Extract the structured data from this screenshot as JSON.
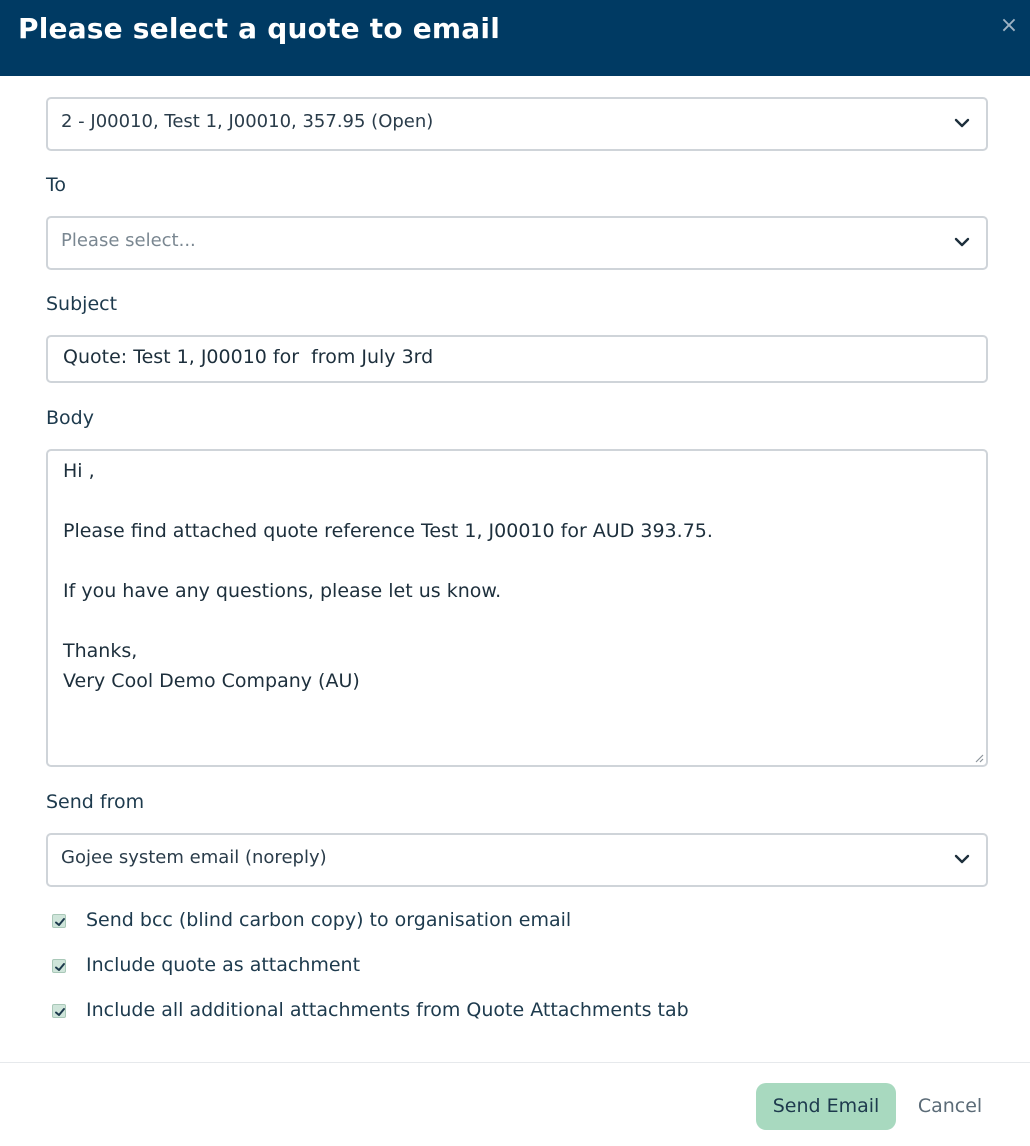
{
  "dialog": {
    "title": "Please select a quote to email",
    "close_glyph": "×"
  },
  "quote_select": {
    "selected": "2 - J00010, Test 1, J00010, 357.95 (Open)"
  },
  "to": {
    "label": "To",
    "placeholder": "Please select..."
  },
  "subject": {
    "label": "Subject",
    "value": "Quote: Test 1, J00010 for  from July 3rd"
  },
  "body": {
    "label": "Body",
    "lines": [
      "Hi ,",
      "",
      "Please find attached quote reference Test 1, J00010 for AUD 393.75.",
      "",
      "If you have any questions, please let us know.",
      "",
      "Thanks,",
      "Very Cool Demo Company (AU)"
    ]
  },
  "send_from": {
    "label": "Send from",
    "selected": "Gojee system email (noreply)"
  },
  "options": [
    {
      "label": "Send bcc (blind carbon copy) to organisation email",
      "checked": true
    },
    {
      "label": "Include quote as attachment",
      "checked": true
    },
    {
      "label": "Include all additional attachments from Quote Attachments tab",
      "checked": true
    }
  ],
  "footer": {
    "send_label": "Send Email",
    "cancel_label": "Cancel"
  },
  "colors": {
    "header_bg": "#003a63",
    "primary_button": "#a8d9bf",
    "checkbox": "#cfe5da"
  },
  "icons": {
    "close": "close-icon",
    "dropdown": "chevron-down-icon",
    "check": "checkmark-icon"
  }
}
